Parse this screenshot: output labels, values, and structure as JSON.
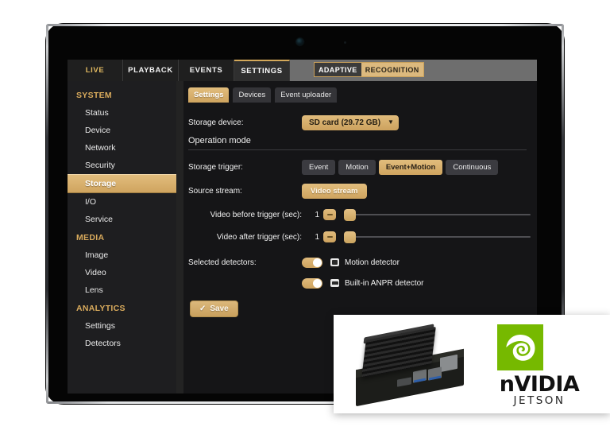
{
  "device": {
    "type": "tablet",
    "camera": "front-camera"
  },
  "topbar": {
    "tabs": [
      {
        "label": "LIVE",
        "active": false,
        "gold": true
      },
      {
        "label": "PLAYBACK",
        "active": false,
        "gold": false
      },
      {
        "label": "EVENTS",
        "active": false,
        "gold": false
      },
      {
        "label": "SETTINGS",
        "active": true,
        "gold": false
      }
    ],
    "brand": {
      "part1": "ADAPTIVE",
      "part2": "RECOGNITION"
    }
  },
  "sidebar": {
    "groups": [
      {
        "title": "SYSTEM",
        "items": [
          {
            "label": "Status",
            "active": false
          },
          {
            "label": "Device",
            "active": false
          },
          {
            "label": "Network",
            "active": false
          },
          {
            "label": "Security",
            "active": false
          },
          {
            "label": "Storage",
            "active": true
          },
          {
            "label": "I/O",
            "active": false
          },
          {
            "label": "Service",
            "active": false
          }
        ]
      },
      {
        "title": "MEDIA",
        "items": [
          {
            "label": "Image",
            "active": false
          },
          {
            "label": "Video",
            "active": false
          },
          {
            "label": "Lens",
            "active": false
          }
        ]
      },
      {
        "title": "ANALYTICS",
        "items": [
          {
            "label": "Settings",
            "active": false
          },
          {
            "label": "Detectors",
            "active": false
          }
        ]
      }
    ]
  },
  "content": {
    "subtabs": [
      {
        "label": "Settings",
        "active": true
      },
      {
        "label": "Devices",
        "active": false
      },
      {
        "label": "Event uploader",
        "active": false
      }
    ],
    "storage_device": {
      "label": "Storage device:",
      "value": "SD card (29.72 GB)",
      "chevron": "chevron-down-icon"
    },
    "operation_mode": {
      "title": "Operation mode"
    },
    "storage_trigger": {
      "label": "Storage trigger:",
      "options": [
        {
          "label": "Event",
          "active": false
        },
        {
          "label": "Motion",
          "active": false
        },
        {
          "label": "Event+Motion",
          "active": true
        },
        {
          "label": "Continuous",
          "active": false
        }
      ]
    },
    "source_stream": {
      "label": "Source stream:",
      "value": "Video stream"
    },
    "video_before": {
      "label": "Video before trigger (sec):",
      "value": "1",
      "slider_percent": 0
    },
    "video_after": {
      "label": "Video after trigger (sec):",
      "value": "1",
      "slider_percent": 0
    },
    "detectors": {
      "label": "Selected detectors:",
      "items": [
        {
          "label": "Motion detector",
          "enabled": true,
          "icon": "motion-detector-icon"
        },
        {
          "label": "Built-in ANPR detector",
          "enabled": true,
          "icon": "anpr-detector-icon"
        }
      ]
    },
    "save": {
      "label": "Save",
      "icon": "check-icon"
    }
  },
  "nvidia_card": {
    "brand": "nVIDIA",
    "brand_prefix": "n",
    "brand_rest": "VIDIA",
    "product": "JETSON",
    "board_alt": "jetson-nano-board",
    "logo_alt": "nvidia-eye-logo",
    "logo_color": "#76b900"
  },
  "colors": {
    "gold": "#d3a85a",
    "gold_light": "#e2bd7d",
    "gold_dark": "#cfa45f",
    "panel_bg": "#151517",
    "sidebar_bg": "#1e1e20",
    "topbar_bg": "#2a2a2a",
    "nvidia_green": "#76b900"
  }
}
